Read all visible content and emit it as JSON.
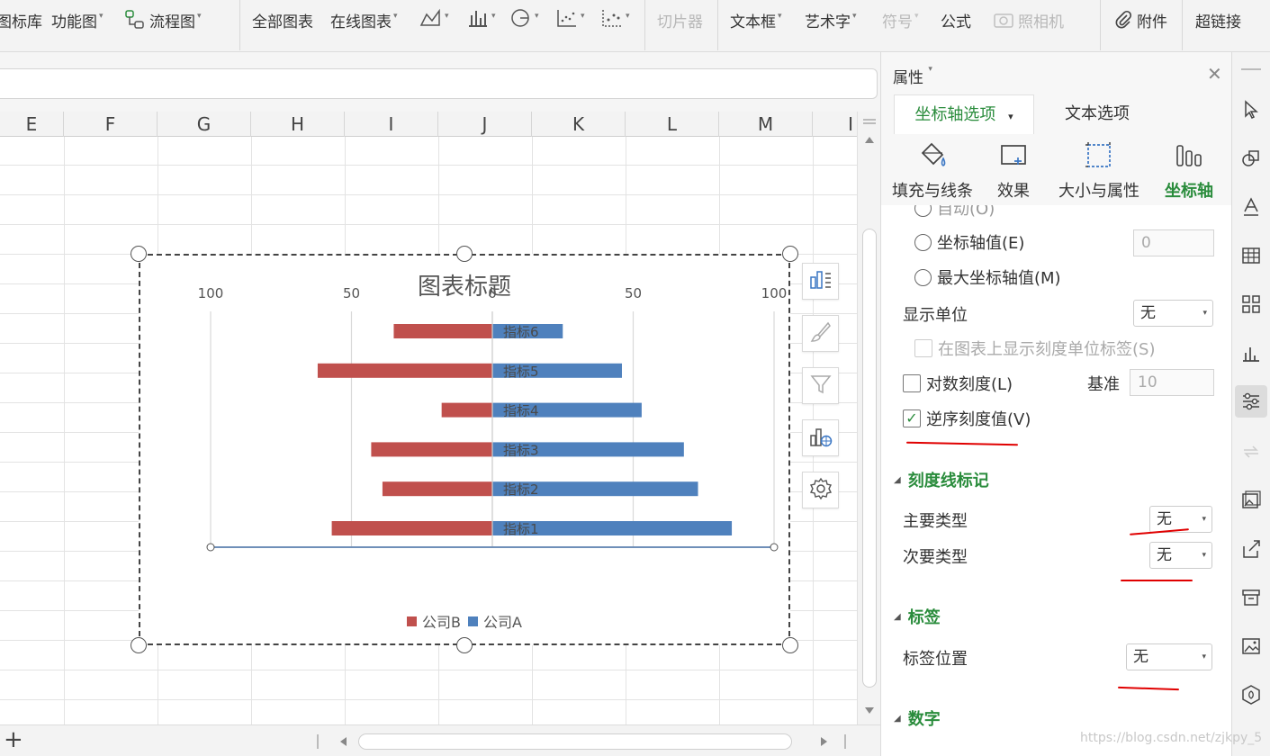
{
  "ribbon": {
    "items": [
      {
        "label": "图标库",
        "caret": false,
        "disabled": false
      },
      {
        "label": "功能图",
        "caret": true,
        "disabled": false
      },
      {
        "label": "流程图",
        "caret": true,
        "disabled": false
      },
      {
        "label": "全部图表",
        "caret": false,
        "disabled": false
      },
      {
        "label": "在线图表",
        "caret": true,
        "disabled": false
      },
      {
        "label": "切片器",
        "caret": false,
        "disabled": true
      },
      {
        "label": "文本框",
        "caret": true,
        "disabled": false
      },
      {
        "label": "艺术字",
        "caret": true,
        "disabled": false
      },
      {
        "label": "符号",
        "caret": true,
        "disabled": true
      },
      {
        "label": "公式",
        "caret": false,
        "disabled": false
      },
      {
        "label": "照相机",
        "caret": false,
        "disabled": true
      },
      {
        "label": "附件",
        "caret": false,
        "disabled": false
      },
      {
        "label": "超链接",
        "caret": false,
        "disabled": false
      }
    ],
    "caret_glyph": "▾"
  },
  "sheet": {
    "columns": [
      "E",
      "F",
      "G",
      "H",
      "I",
      "J",
      "K",
      "L",
      "M",
      "I"
    ],
    "add_sheet_label": "+"
  },
  "chart_data": {
    "type": "bar",
    "orientation": "horizontal",
    "title": "图表标题",
    "categories": [
      "指标1",
      "指标2",
      "指标3",
      "指标4",
      "指标5",
      "指标6"
    ],
    "series": [
      {
        "name": "公司B",
        "color": "#c0504d",
        "values": [
          57,
          39,
          43,
          18,
          62,
          35
        ]
      },
      {
        "name": "公司A",
        "color": "#4f81bd",
        "values": [
          85,
          73,
          68,
          53,
          46,
          25
        ]
      }
    ],
    "axis_ticks": [
      "100",
      "50",
      "0",
      "50",
      "100"
    ],
    "xlim": [
      -100,
      100
    ],
    "grid": true,
    "legend_position": "bottom"
  },
  "panel": {
    "title": "属性",
    "title_caret": "▾",
    "close_glyph": "✕",
    "tabs": {
      "axis_options": "坐标轴选项",
      "text_options": "文本选项",
      "axis_caret": "▾"
    },
    "subtabs": [
      "填充与线条",
      "效果",
      "大小与属性",
      "坐标轴"
    ],
    "partial_option": "自动(O)",
    "axis_value_label": "坐标轴值(E)",
    "axis_value_input": "0",
    "max_axis_value_label": "最大坐标轴值(M)",
    "display_unit_label": "显示单位",
    "display_unit_value": "无",
    "show_unit_label": "在图表上显示刻度单位标签(S)",
    "log_scale_label": "对数刻度(L)",
    "base_label": "基准",
    "base_value": "10",
    "reverse_label": "逆序刻度值(V)",
    "reverse_checked": true,
    "section_ticks": "刻度线标记",
    "major_type_label": "主要类型",
    "major_type_value": "无",
    "minor_type_label": "次要类型",
    "minor_type_value": "无",
    "section_labels": "标签",
    "label_position_label": "标签位置",
    "label_position_value": "无",
    "section_number": "数字",
    "section_triangle": "◢",
    "dropdown_glyph": "▾",
    "check_glyph": "✓"
  },
  "watermark": "https://blog.csdn.net/zjkpy_5",
  "colors": {
    "accent_green": "#2a8c3c",
    "annotation_red": "#e00000"
  }
}
